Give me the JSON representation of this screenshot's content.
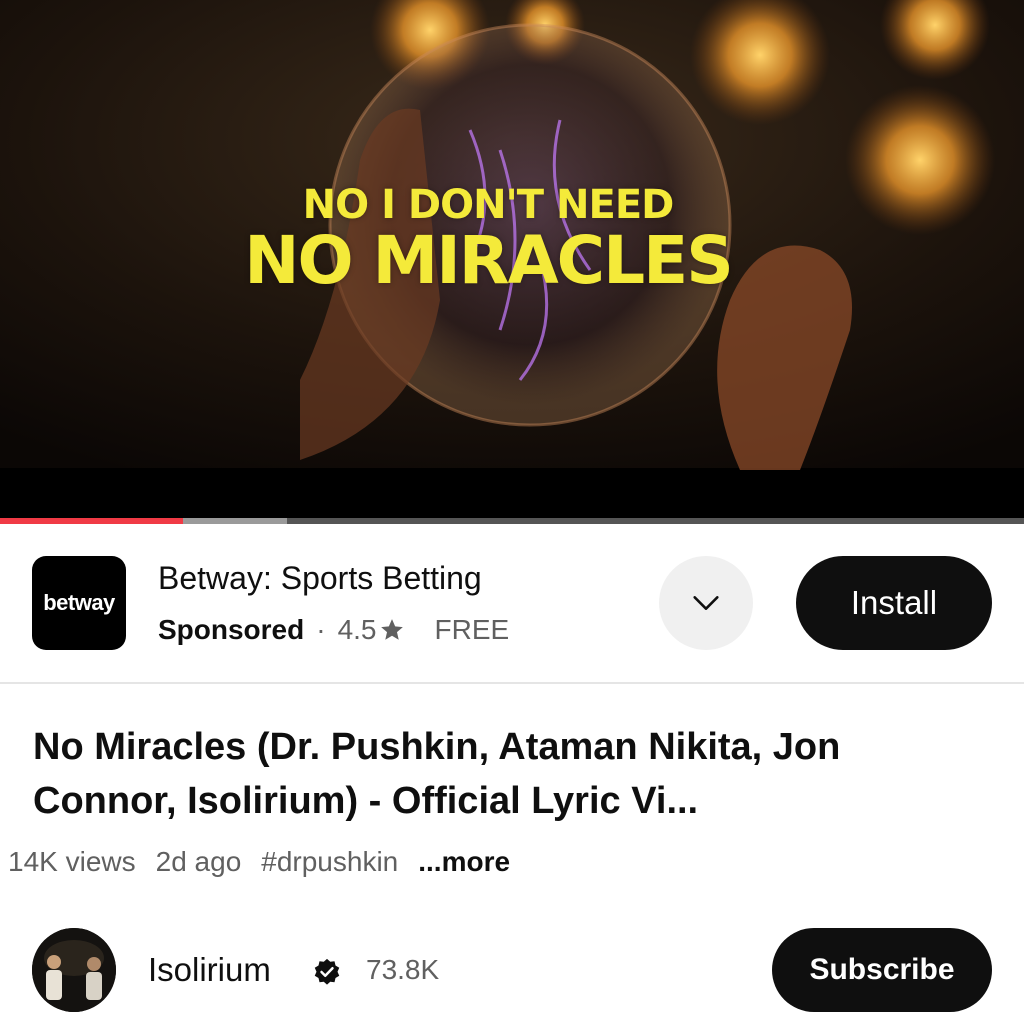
{
  "video": {
    "lyric_line1": "NO I DON'T NEED",
    "lyric_line2": "NO MIRACLES",
    "lyric_color": "#f4ea3a",
    "progress": {
      "played": 0.179,
      "buffered": 0.28
    }
  },
  "ad": {
    "logo_text": "betway",
    "title": "Betway: Sports Betting",
    "sponsored": "Sponsored",
    "separator": "·",
    "rating": "4.5",
    "price": "FREE",
    "install_label": "Install",
    "expand_icon": "chevron-down-icon"
  },
  "details": {
    "title": "No Miracles (Dr. Pushkin, Ataman Nikita, Jon Connor, Isolirium) -  Official Lyric Vi...",
    "views": "14K views",
    "age": "2d ago",
    "hashtag": "#drpushkin",
    "more": "...more"
  },
  "channel": {
    "name": "Isolirium",
    "verified_icon": "verified-badge-icon",
    "subscribers": "73.8K",
    "subscribe_label": "Subscribe"
  },
  "colors": {
    "accent_red": "#f03a45",
    "button_dark": "#0f0f0f",
    "secondary_text": "#606060"
  }
}
